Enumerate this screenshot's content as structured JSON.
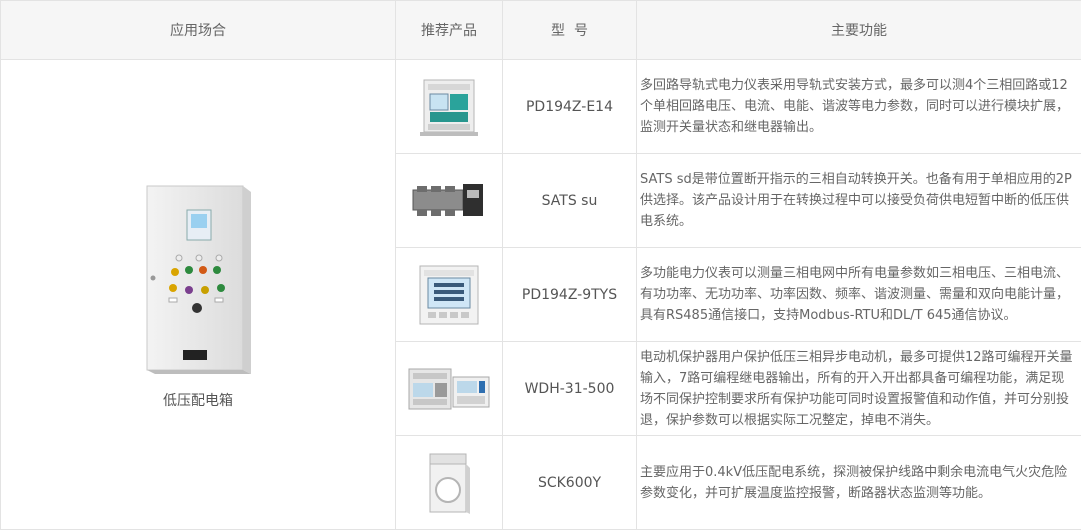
{
  "header": {
    "application": "应用场合",
    "product": "推荐产品",
    "model": "型  号",
    "function": "主要功能"
  },
  "application": {
    "name": "低压配电箱",
    "image": "distribution-cabinet-image"
  },
  "rows": [
    {
      "model": "PD194Z-E14",
      "image": "din-rail-meter-image",
      "function": "多回路导轨式电力仪表采用导轨式安装方式，最多可以测4个三相回路或12个单相回路电压、电流、电能、谐波等电力参数，同时可以进行模块扩展，监测开关量状态和继电器输出。"
    },
    {
      "model": "SATS su",
      "image": "transfer-switch-image",
      "function": "SATS sd是带位置断开指示的三相自动转换开关。也备有用于单相应用的2P供选择。该产品设计用于在转换过程中可以接受负荷供电短暂中断的低压供电系统。"
    },
    {
      "model": "PD194Z-9TYS",
      "image": "panel-meter-image",
      "function": "多功能电力仪表可以测量三相电网中所有电量参数如三相电压、三相电流、有功功率、无功功率、功率因数、频率、谐波测量、需量和双向电能计量，具有RS485通信接口，支持Modbus-RTU和DL/T 645通信协议。"
    },
    {
      "model": "WDH-31-500",
      "image": "motor-protector-image",
      "function": "电动机保护器用户保护低压三相异步电动机，最多可提供12路可编程开关量输入，7路可编程继电器输出，所有的开入开出都具备可编程功能，满足现场不同保护控制要求所有保护功能可同时设置报警值和动作值，并可分别投退，保护参数可以根据实际工况整定，掉电不消失。"
    },
    {
      "model": "SCK600Y",
      "image": "current-transformer-image",
      "function": "主要应用于0.4kV低压配电系统，探测被保护线路中剩余电流电气火灾危险参数变化，并可扩展温度监控报警，断路器状态监测等功能。"
    }
  ]
}
